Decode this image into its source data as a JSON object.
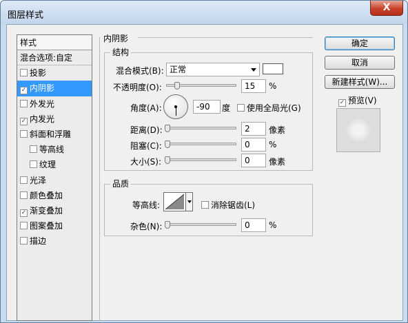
{
  "window": {
    "title": "图层样式",
    "close": "X"
  },
  "styles": {
    "header": "样式",
    "blend": "混合选项:自定",
    "items": [
      {
        "label": "投影",
        "checked": false
      },
      {
        "label": "内阴影",
        "checked": true,
        "selected": true
      },
      {
        "label": "外发光",
        "checked": false
      },
      {
        "label": "内发光",
        "checked": true
      },
      {
        "label": "斜面和浮雕",
        "checked": false
      },
      {
        "label": "等高线",
        "checked": false,
        "sub": true
      },
      {
        "label": "纹理",
        "checked": false,
        "sub": true
      },
      {
        "label": "光泽",
        "checked": false
      },
      {
        "label": "颜色叠加",
        "checked": false
      },
      {
        "label": "渐变叠加",
        "checked": true
      },
      {
        "label": "图案叠加",
        "checked": false
      },
      {
        "label": "描边",
        "checked": false
      }
    ]
  },
  "panel": {
    "title": "内阴影",
    "structure": {
      "title": "结构",
      "blend_mode_label": "混合模式(B):",
      "blend_mode_value": "正常",
      "color": "#ffffff",
      "opacity_label": "不透明度(O):",
      "opacity_value": "15",
      "opacity_unit": "%",
      "opacity_level": 15,
      "angle_label": "角度(A):",
      "angle_value": "-90",
      "angle_unit": "度",
      "global_light_label": "使用全局光(G)",
      "global_light_checked": false,
      "distance_label": "距离(D):",
      "distance_value": "2",
      "distance_unit": "像素",
      "choke_label": "阻塞(C):",
      "choke_value": "0",
      "choke_unit": "%",
      "size_label": "大小(S):",
      "size_value": "0",
      "size_unit": "像素"
    },
    "quality": {
      "title": "品质",
      "contour_label": "等高线:",
      "anti_alias_label": "消除锯齿(L)",
      "anti_alias_checked": false,
      "noise_label": "杂色(N):",
      "noise_value": "0",
      "noise_unit": "%"
    }
  },
  "buttons": {
    "ok": "确定",
    "cancel": "取消",
    "new_style": "新建样式(W)...",
    "preview_label": "预览(V)",
    "preview_checked": true
  }
}
